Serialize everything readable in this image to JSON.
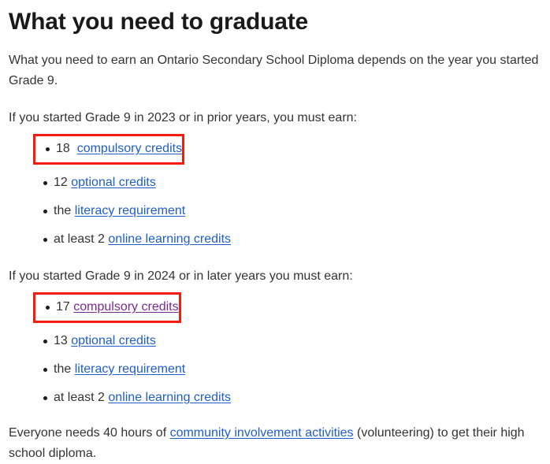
{
  "page": {
    "title": "What you need to graduate",
    "intro": "What you need to earn an Ontario Secondary School Diploma depends on the year you started Grade 9.",
    "final_paragraph": {
      "before_link": "Everyone needs 40 hours of ",
      "link": "community involvement activities",
      "after_link": " (volunteering) to get their high school diploma."
    }
  },
  "sections": [
    {
      "lead": "If you started Grade 9 in 2023 or in prior years, you must earn:",
      "items": [
        {
          "prefix": "18",
          "gap": "  ",
          "link": "compulsory credits",
          "link_color": "blue",
          "highlighted": true
        },
        {
          "prefix": "12",
          "gap": " ",
          "link": "optional credits",
          "link_color": "blue",
          "highlighted": false
        },
        {
          "prefix": "the",
          "gap": " ",
          "link": "literacy requirement",
          "link_color": "blue",
          "highlighted": false
        },
        {
          "prefix": "at least 2",
          "gap": " ",
          "link": "online learning credits",
          "link_color": "blue",
          "highlighted": false
        }
      ]
    },
    {
      "lead": "If you started Grade 9 in 2024 or in later years you must earn:",
      "items": [
        {
          "prefix": "17",
          "gap": " ",
          "link": "compulsory credits",
          "link_color": "purple",
          "highlighted": true
        },
        {
          "prefix": "13",
          "gap": " ",
          "link": "optional credits",
          "link_color": "blue",
          "highlighted": false
        },
        {
          "prefix": "the",
          "gap": " ",
          "link": "literacy requirement",
          "link_color": "blue",
          "highlighted": false
        },
        {
          "prefix": "at least 2",
          "gap": " ",
          "link": "online learning credits",
          "link_color": "blue",
          "highlighted": false
        }
      ]
    }
  ],
  "colors": {
    "highlight_border": "#f51c0f",
    "link_blue": "#1f5eca",
    "link_visited_purple": "#7a2a8f",
    "heading": "#1a1a1a",
    "body_text": "#333333",
    "background": "#ffffff"
  }
}
